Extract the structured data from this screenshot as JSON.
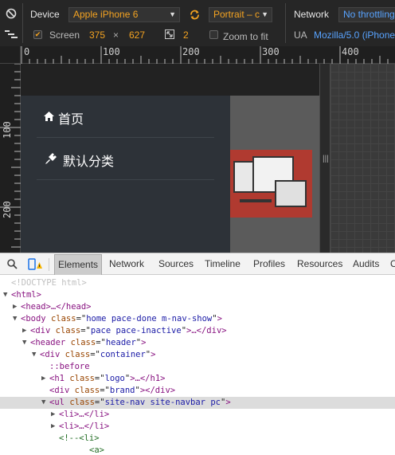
{
  "emulation": {
    "device_label": "Device",
    "device_value": "Apple iPhone 6",
    "orientation_value": "Portrait – c",
    "network_label": "Network",
    "network_value": "No throttling",
    "screen_label": "Screen",
    "screen_width": "375",
    "times": "×",
    "screen_height": "627",
    "dpr_value": "2",
    "zoom_to_fit_label": "Zoom to fit",
    "ua_label": "UA",
    "ua_value": "Mozilla/5.0 (iPhone"
  },
  "ruler": {
    "top_ticks": [
      "0",
      "100",
      "200",
      "300",
      "400"
    ],
    "left_ticks": [
      "100",
      "200"
    ]
  },
  "site": {
    "nav_items": [
      {
        "icon": "home-icon",
        "label": "首页"
      },
      {
        "icon": "plug-icon",
        "label": "默认分类"
      }
    ],
    "drag_handle": "|||"
  },
  "devtools": {
    "tabs": [
      "Elements",
      "Network",
      "Sources",
      "Timeline",
      "Profiles",
      "Resources",
      "Audits",
      "C"
    ],
    "active_tab": "Elements"
  },
  "elements_tree": {
    "doctype": "<!DOCTYPE html>",
    "html_open": "<html>",
    "head": "<head>…</head>",
    "body": {
      "tag": "body",
      "attr": "class",
      "value": "home  pace-done m-nav-show"
    },
    "div_pace": {
      "tag": "div",
      "attr": "class",
      "value": "pace  pace-inactive",
      "tail": "…</div>"
    },
    "header": {
      "tag": "header",
      "attr": "class",
      "value": "header"
    },
    "div_container": {
      "tag": "div",
      "attr": "class",
      "value": "container"
    },
    "before": "::before",
    "h1": {
      "tag": "h1",
      "attr": "class",
      "value": "logo",
      "tail": "…</h1>"
    },
    "div_brand": {
      "tag": "div",
      "attr": "class",
      "value": "brand",
      "tail": "</div>"
    },
    "ul": {
      "tag": "ul",
      "attr": "class",
      "value": "site-nav site-navbar pc"
    },
    "li_1": "<li>…</li>",
    "li_2": "<li>…</li>",
    "comment_li": "<!--<li>",
    "a_tag": "<a>"
  }
}
